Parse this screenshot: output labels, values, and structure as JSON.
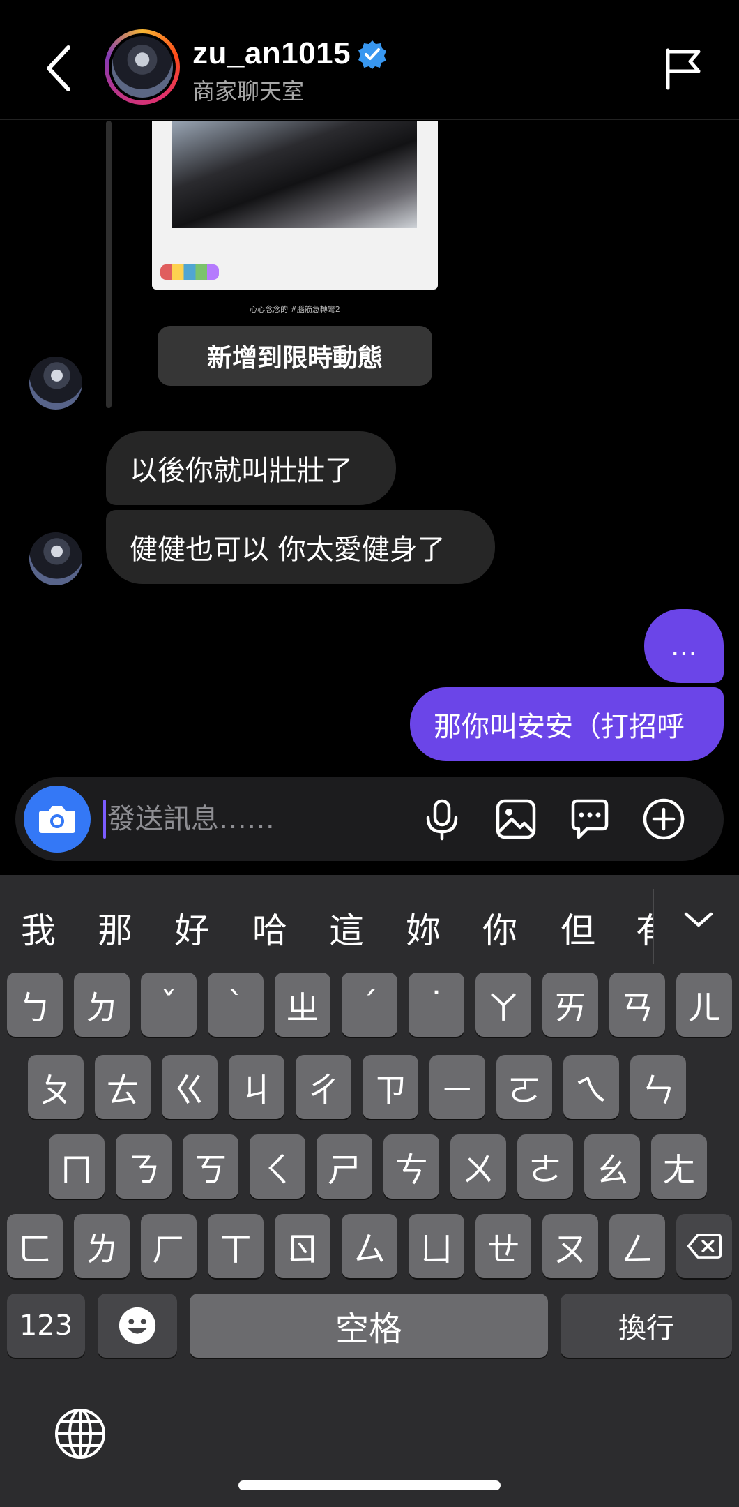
{
  "header": {
    "username": "zu_an1015",
    "subtitle": "商家聊天室"
  },
  "story": {
    "caption": "心心念念的 #腦筋急轉彎2",
    "add_story_label": "新增到限時動態"
  },
  "messages": {
    "incoming": [
      "以後你就叫壯壯了",
      "健健也可以 你太愛健身了"
    ],
    "outgoing": [
      "...",
      "那你叫安安（打招呼"
    ]
  },
  "composer": {
    "placeholder": "發送訊息……"
  },
  "keyboard": {
    "candidates": [
      "我",
      "那",
      "好",
      "哈",
      "這",
      "妳",
      "你",
      "但",
      "有"
    ],
    "row1": [
      "ㄅ",
      "ㄉ",
      "ˇ",
      "ˋ",
      "ㄓ",
      "ˊ",
      "˙",
      "ㄚ",
      "ㄞ",
      "ㄢ",
      "ㄦ"
    ],
    "row2": [
      "ㄆ",
      "ㄊ",
      "ㄍ",
      "ㄐ",
      "ㄔ",
      "ㄗ",
      "ㄧ",
      "ㄛ",
      "ㄟ",
      "ㄣ"
    ],
    "row3": [
      "ㄇ",
      "ㄋ",
      "ㄎ",
      "ㄑ",
      "ㄕ",
      "ㄘ",
      "ㄨ",
      "ㄜ",
      "ㄠ",
      "ㄤ"
    ],
    "row4": [
      "ㄈ",
      "ㄌ",
      "ㄏ",
      "ㄒ",
      "ㄖ",
      "ㄙ",
      "ㄩ",
      "ㄝ",
      "ㄡ",
      "ㄥ"
    ],
    "numbers_label": "123",
    "space_label": "空格",
    "return_label": "換行"
  },
  "icons": {
    "back": "chevron-left-icon",
    "verified": "verified-badge-icon",
    "flag": "flag-icon",
    "camera": "camera-icon",
    "mic": "microphone-icon",
    "gallery": "image-icon",
    "sticker": "chat-bubble-icon",
    "more": "plus-circle-icon",
    "emoji": "emoji-icon",
    "delete": "backspace-icon",
    "globe": "globe-icon",
    "expand": "chevron-down-icon"
  },
  "colors": {
    "accent": "#6b45e8",
    "verified": "#3897f0",
    "camera": "#3478f6"
  }
}
